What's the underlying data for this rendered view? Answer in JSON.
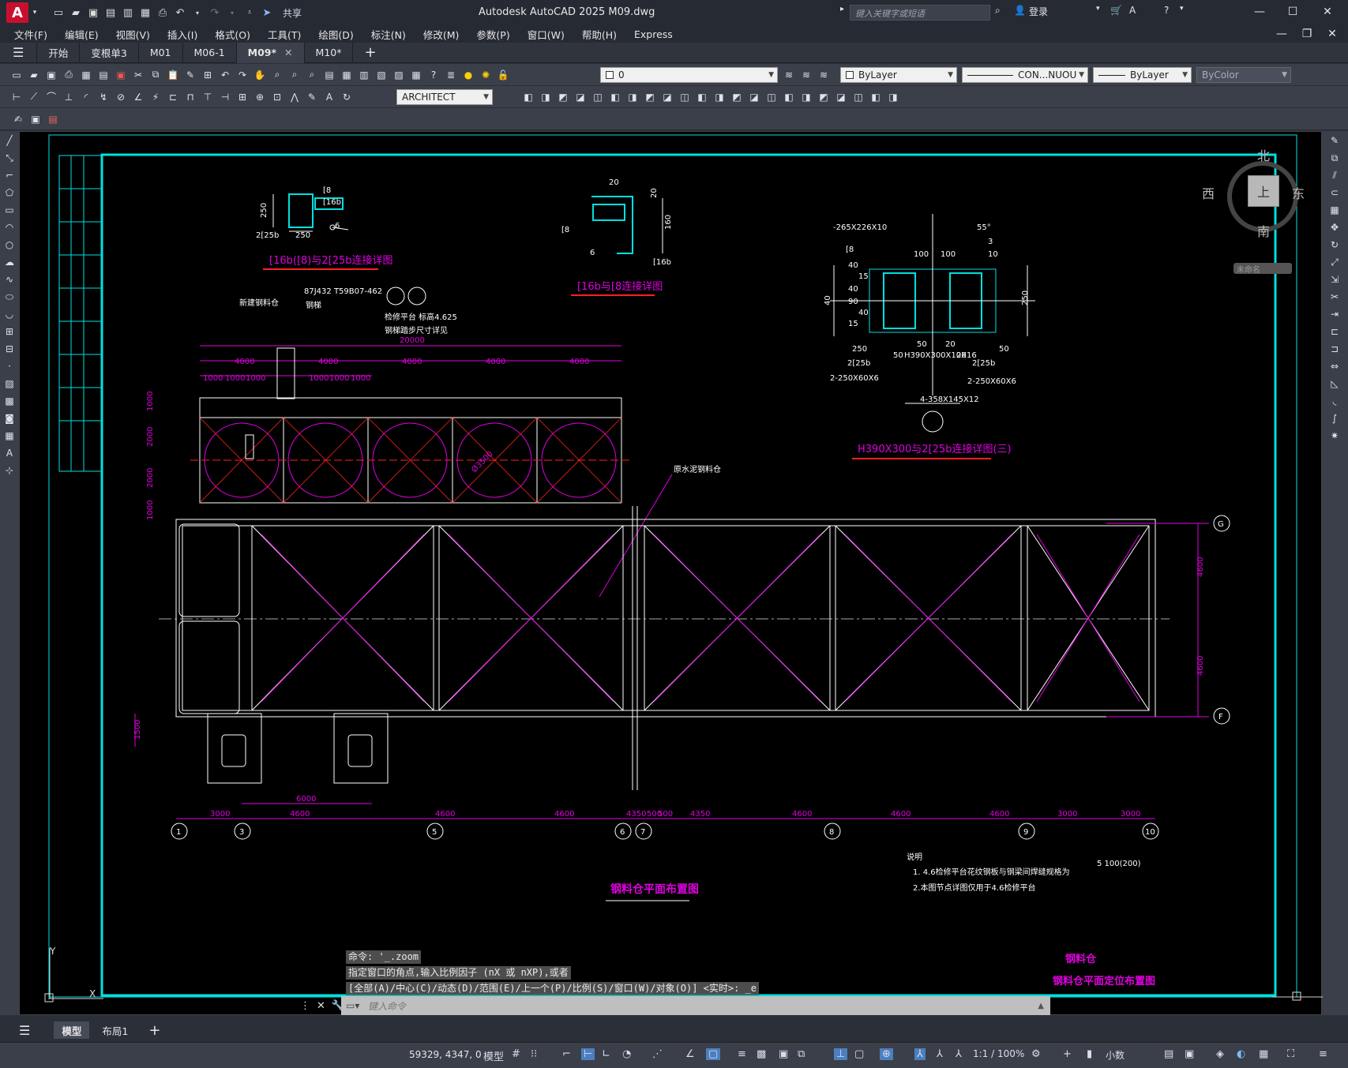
{
  "title_bar": {
    "app_letter": "A",
    "share_label": "共享",
    "title": "Autodesk AutoCAD 2025    M09.dwg",
    "search_placeholder": "键入关键字或短语",
    "login_label": "登录"
  },
  "menu": [
    "文件(F)",
    "编辑(E)",
    "视图(V)",
    "插入(I)",
    "格式(O)",
    "工具(T)",
    "绘图(D)",
    "标注(N)",
    "修改(M)",
    "参数(P)",
    "窗口(W)",
    "帮助(H)",
    "Express"
  ],
  "tabs": [
    {
      "label": "开始",
      "active": false
    },
    {
      "label": "变根单3",
      "active": false
    },
    {
      "label": "M01",
      "active": false
    },
    {
      "label": "M06-1",
      "active": false
    },
    {
      "label": "M09*",
      "active": true
    },
    {
      "label": "M10*",
      "active": false
    }
  ],
  "toolbar": {
    "layer_value": "0",
    "color_value": "ByLayer",
    "linetype_value": "CON...NUOU",
    "lineweight_value": "ByLayer",
    "plotstyle_value": "ByColor",
    "dimstyle_value": "ARCHITECT"
  },
  "viewcube": {
    "north": "北",
    "south": "南",
    "east": "东",
    "west": "西",
    "top": "上",
    "wcs": "未命名"
  },
  "drawing": {
    "detail1_title": "[16b([8)与2[25b连接详图",
    "detail2_title": "[16b与[8连接详图",
    "detail3_title": "H390X300与2[25b连接详图(三)",
    "plan_title": "钢料仓平面布置图",
    "titleblock_line1": "钢料仓",
    "titleblock_line2": "钢料仓平面定位布置图",
    "notes_heading": "说明",
    "note1": "1. 4.6检修平台花纹钢板与钢梁间焊缝规格为",
    "note2": "2.本图节点详图仅用于4.6检修平台",
    "weld_spec": "5 100(200)",
    "label_new_bin": "新建钢料仓",
    "label_old_bin": "原水泥钢料仓",
    "label_ref": "87J432 T59B07-462",
    "label_stair": "钢梯",
    "label_platform": "检修平台    标高4.625",
    "label_platform2": "钢梯踏步尺寸详见",
    "dim_total": "20000",
    "dims_top": [
      "4000",
      "4000",
      "4000",
      "4000",
      "4000"
    ],
    "dims_small": [
      "1000",
      "1000",
      "1000",
      "1000",
      "1000",
      "1000"
    ],
    "dims_left": [
      "1000",
      "2000",
      "2000",
      "1000"
    ],
    "dim_diameter": "Ø3500",
    "dims_right": [
      "4600",
      "4600"
    ],
    "dim_left_bottom": "1500",
    "dim_6000": "6000",
    "dims_bottom": [
      "3000",
      "4600",
      "4600",
      "4600",
      "4350",
      "500",
      "500",
      "4350",
      "4600",
      "4600",
      "4600",
      "3000",
      "3000"
    ],
    "axes_bottom": [
      "1",
      "3",
      "5",
      "6",
      "7",
      "8",
      "9",
      "10"
    ],
    "axes_right": [
      "G",
      "F"
    ],
    "d1_labels": [
      "[8",
      "[16b",
      "250",
      "2[25b",
      "250",
      "6"
    ],
    "d2_labels": [
      "20",
      "20",
      "160",
      "[8",
      "6",
      "[16b"
    ],
    "d3_labels": [
      "-265X226X10",
      "[8",
      "55°",
      "3",
      "100",
      "100",
      "10",
      "40",
      "15",
      "40",
      "90",
      "40",
      "15",
      "40",
      "250",
      "250",
      "2[25b",
      "2-250X60X6",
      "H390X300X10X16",
      "50",
      "50",
      "20",
      "20",
      "50",
      "2[25b",
      "2-250X60X6",
      "4-358X145X12",
      "300"
    ]
  },
  "command": {
    "history1": "命令: '_.zoom",
    "history2": "指定窗口的角点,输入比例因子 (nX 或 nXP),或者",
    "history3": "[全部(A)/中心(C)/动态(D)/范围(E)/上一个(P)/比例(S)/窗口(W)/对象(O)] <实时>: _e",
    "placeholder": "键入命令"
  },
  "layout_tabs": [
    "模型",
    "布局1"
  ],
  "status": {
    "coords": "59329, 4347, 0",
    "model_label": "模型",
    "scale": "1:1 / 100%",
    "units": "小数"
  }
}
